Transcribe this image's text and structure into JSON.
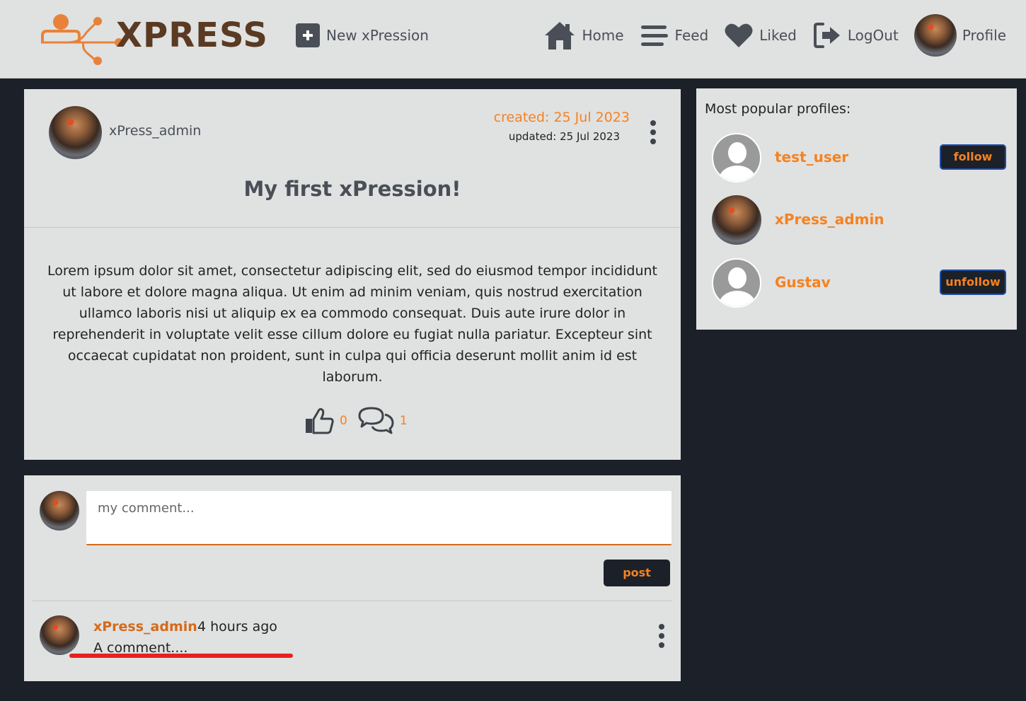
{
  "brand": {
    "logo_text": "XPRESS"
  },
  "nav": {
    "new_label": "New xPression",
    "home_label": "Home",
    "feed_label": "Feed",
    "liked_label": "Liked",
    "logout_label": "LogOut",
    "profile_label": "Profile"
  },
  "post": {
    "author": "xPress_admin",
    "created": "created: 25 Jul 2023",
    "updated": "updated: 25 Jul 2023",
    "title": "My first xPression!",
    "body": "Lorem ipsum dolor sit amet, consectetur adipiscing elit, sed do eiusmod tempor incididunt ut labore et dolore magna aliqua. Ut enim ad minim veniam, quis nostrud exercitation ullamco laboris nisi ut aliquip ex ea commodo consequat. Duis aute irure dolor in reprehenderit in voluptate velit esse cillum dolore eu fugiat nulla pariatur. Excepteur sint occaecat cupidatat non proident, sunt in culpa qui officia deserunt mollit anim id est laborum.",
    "likes_count": "0",
    "comments_count": "1"
  },
  "comment_form": {
    "placeholder": "my comment...",
    "post_label": "post"
  },
  "comments": [
    {
      "user": "xPress_admin",
      "time": "4 hours ago",
      "text": "A comment...."
    }
  ],
  "sidebar": {
    "title": "Most popular profiles:",
    "profiles": [
      {
        "name": "test_user",
        "button": "follow"
      },
      {
        "name": "xPress_admin",
        "button": ""
      },
      {
        "name": "Gustav",
        "button": "unfollow"
      }
    ]
  },
  "colors": {
    "accent": "#f58220",
    "dark": "#1c2028",
    "card": "#e0e1e1"
  }
}
